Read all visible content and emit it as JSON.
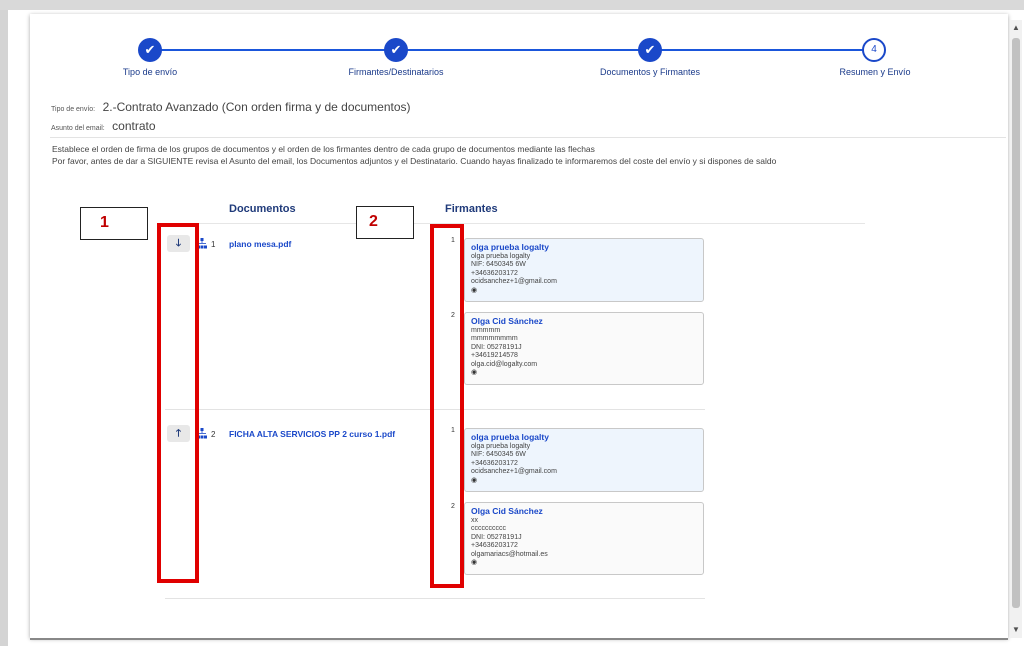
{
  "stepper": {
    "steps": [
      {
        "label": "Tipo de envío",
        "state": "done",
        "glyph": "✔"
      },
      {
        "label": "Firmantes/Destinatarios",
        "state": "done",
        "glyph": "✔"
      },
      {
        "label": "Documentos y Firmantes",
        "state": "done",
        "glyph": "✔"
      },
      {
        "label": "Resumen y Envío",
        "state": "current",
        "glyph": "4"
      }
    ]
  },
  "summary": {
    "tipo_label": "Tipo de envío:",
    "tipo_value": "2.-Contrato Avanzado (Con orden firma y de documentos)",
    "asunto_label": "Asunto del email:",
    "asunto_value": "contrato"
  },
  "instructions": {
    "line1": "Establece el orden de firma de los grupos de documentos y el orden de los firmantes dentro de cada grupo de documentos mediante las flechas",
    "line2": "Por favor, antes de dar a SIGUIENTE revisa el Asunto del email, los Documentos adjuntos y el Destinatario. Cuando hayas finalizado te informaremos del coste del envío y si dispones de saldo"
  },
  "columns": {
    "documents": "Documentos",
    "signers": "Firmantes"
  },
  "groups": [
    {
      "arrow": "🡓",
      "number": "1",
      "document": "plano mesa.pdf",
      "signers": [
        {
          "order": "1",
          "style": "blue",
          "name": "olga prueba logalty",
          "lines": [
            "olga prueba logalty",
            "NIF: 6450345 6W",
            "+34636203172",
            "ocidsanchez+1@gmail.com"
          ]
        },
        {
          "order": "2",
          "style": "white",
          "name": "Olga Cid Sánchez",
          "lines": [
            "mmmmm",
            "mmmmmmmm",
            "DNI: 05278191J",
            "+34619214578",
            "olga.cid@logalty.com"
          ]
        }
      ]
    },
    {
      "arrow": "🡑",
      "number": "2",
      "document": "FICHA ALTA SERVICIOS PP 2 curso 1.pdf",
      "signers": [
        {
          "order": "1",
          "style": "blue",
          "name": "olga prueba logalty",
          "lines": [
            "olga prueba logalty",
            "NIF: 6450345 6W",
            "+34636203172",
            "ocidsanchez+1@gmail.com"
          ]
        },
        {
          "order": "2",
          "style": "white",
          "name": "Olga Cid Sánchez",
          "lines": [
            "xx",
            "cccccccccc",
            "DNI: 05278191J",
            "+34636203172",
            "olgamariacs@hotmail.es"
          ]
        }
      ]
    }
  ],
  "annotations": {
    "box1": "1",
    "box2": "2"
  },
  "colors": {
    "accent": "#1a48c9",
    "highlight": "#e00000"
  }
}
